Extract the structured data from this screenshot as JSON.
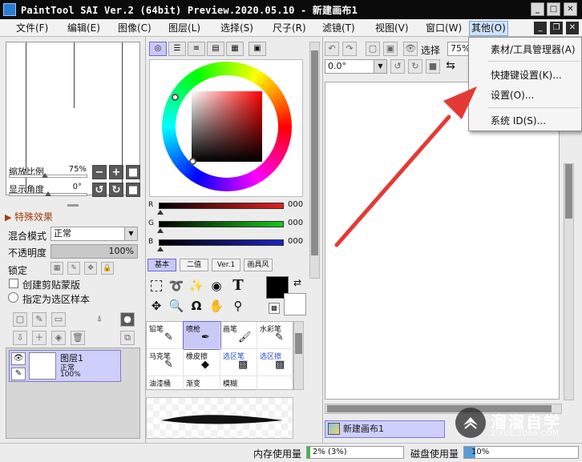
{
  "window": {
    "title": "PaintTool SAI Ver.2 (64bit) Preview.2020.05.10 - 新建画布1",
    "controls": {
      "minimize": "_",
      "maximize": "□",
      "close": "✕"
    }
  },
  "menubar": {
    "items": [
      {
        "label": "文件(F)"
      },
      {
        "label": "编辑(E)"
      },
      {
        "label": "图像(C)"
      },
      {
        "label": "图层(L)"
      },
      {
        "label": "选择(S)"
      },
      {
        "label": "尺子(R)"
      },
      {
        "label": "滤镜(T)"
      },
      {
        "label": "视图(V)"
      },
      {
        "label": "窗口(W)"
      },
      {
        "label": "其他(O)"
      }
    ]
  },
  "dropdown": {
    "items": [
      {
        "label": "素材/工具管理器(A)"
      },
      {
        "label": "快捷键设置(K)..."
      },
      {
        "label": "设置(O)..."
      },
      {
        "label": "系统 ID(S)..."
      }
    ]
  },
  "navigator": {
    "zoom_label": "缩放比例",
    "zoom_value": "75%",
    "angle_label": "显示角度",
    "angle_value": "0°"
  },
  "layer_panel": {
    "effects_label": "特殊效果",
    "blend_label": "混合模式",
    "blend_value": "正常",
    "opacity_label": "不透明度",
    "opacity_value": "100%",
    "opacity": 1.0,
    "lock_label": "锁定",
    "clip_label": "创建剪贴蒙版",
    "selection_source_label": "指定为选区样本",
    "layers": [
      {
        "name": "图层1",
        "mode": "正常",
        "opacity": "100%"
      }
    ]
  },
  "color_panel": {
    "rgb": [
      {
        "channel": "R",
        "value": "000",
        "color": "#e8201e"
      },
      {
        "channel": "G",
        "value": "000",
        "color": "#19c819"
      },
      {
        "channel": "B",
        "value": "000",
        "color": "#1d22c8"
      }
    ],
    "mode_tabs": [
      "基本",
      "二值",
      "Ver.1",
      "画具风"
    ],
    "active_tab": "基本",
    "primary_color": "#000000",
    "secondary_color": "#ffffff"
  },
  "brushes": [
    {
      "name": "铅笔",
      "active": false,
      "blue": false
    },
    {
      "name": "喷枪",
      "active": true,
      "blue": false
    },
    {
      "name": "画笔",
      "active": false,
      "blue": false
    },
    {
      "name": "水彩笔",
      "active": false,
      "blue": false
    },
    {
      "name": "马克笔",
      "active": false,
      "blue": false
    },
    {
      "name": "橡皮擦",
      "active": false,
      "blue": false
    },
    {
      "name": "选区笔",
      "active": false,
      "blue": true
    },
    {
      "name": "选区擦",
      "active": false,
      "blue": true
    },
    {
      "name": "油漆桶",
      "active": false,
      "blue": false
    },
    {
      "name": "渐变",
      "active": false,
      "blue": false
    },
    {
      "name": "模糊",
      "active": false,
      "blue": false
    }
  ],
  "canvas_toolbar": {
    "select_label": "选择",
    "zoom_value": "75%",
    "angle_value": "0.0°"
  },
  "canvas": {
    "tab_name": "新建画布1"
  },
  "statusbar": {
    "memory_label": "内存使用量",
    "memory_value": "2% (3%)",
    "disk_label": "磁盘使用量",
    "disk_value": "10%"
  },
  "watermark": {
    "brand": "溜溜自学",
    "url": "ZIXUE.3D66.COM"
  },
  "accent_color": "#e53935"
}
